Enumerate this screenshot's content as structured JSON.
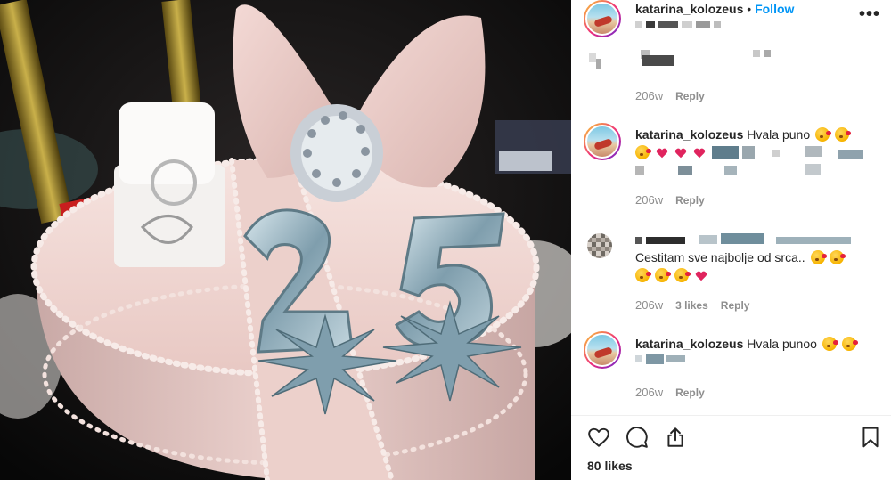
{
  "post": {
    "username": "katarina_kolozeus",
    "separator": "•",
    "follow_label": "Follow",
    "more_icon": "more-horizontal-icon"
  },
  "comments": [
    {
      "time": "206w",
      "reply_label": "Reply",
      "redacted": true
    },
    {
      "username": "katarina_kolozeus",
      "text": "Hvala puno",
      "time": "206w",
      "reply_label": "Reply"
    },
    {
      "text": "Cestitam sve najbolje od srca..",
      "time": "206w",
      "likes": "3 likes",
      "reply_label": "Reply"
    },
    {
      "username": "katarina_kolozeus",
      "text": "Hvala punoo",
      "time": "206w",
      "reply_label": "Reply"
    }
  ],
  "actions": {
    "like_icon": "heart-icon",
    "comment_icon": "comment-icon",
    "share_icon": "share-icon",
    "save_icon": "bookmark-icon"
  },
  "likes_count": "80 likes",
  "colors": {
    "link_blue": "#0095f6",
    "meta_grey": "#8e8e8e",
    "text": "#262626",
    "cake_pink": "#f0d6d3",
    "candle_silver": "#8fb0bd"
  }
}
